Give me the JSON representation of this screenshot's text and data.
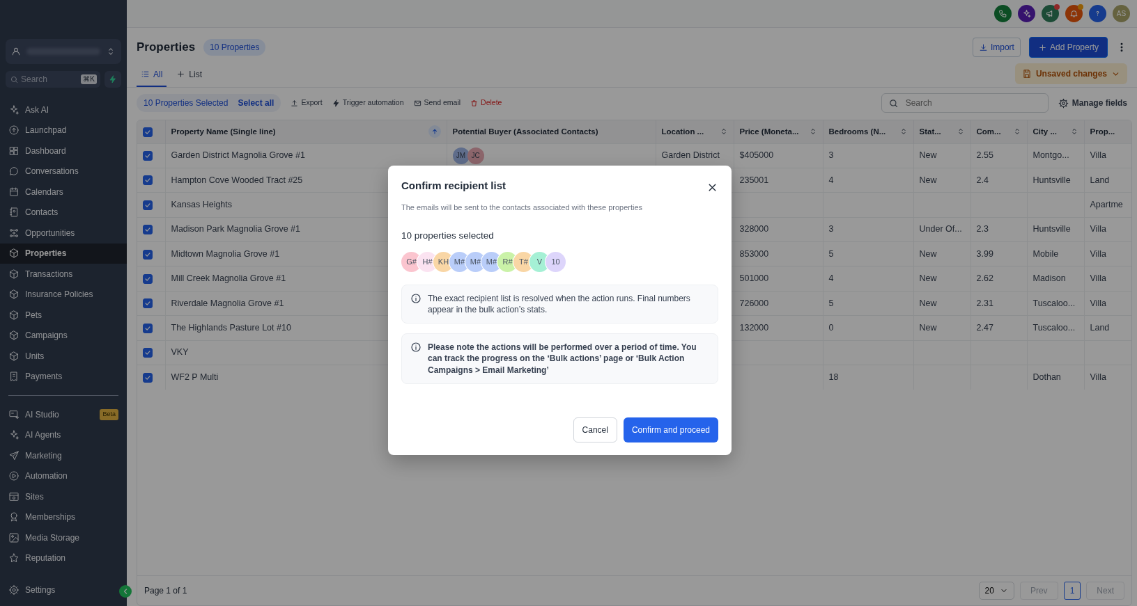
{
  "top_bar": {
    "icons": [
      {
        "notify": false
      },
      {
        "notify": false
      },
      {
        "notify": true
      },
      {
        "notify": true
      },
      {
        "notify": false
      }
    ],
    "avatar": "AS"
  },
  "sidebar": {
    "search": {
      "placeholder": "Search",
      "shortcut": "⌘K"
    },
    "nav": [
      {
        "label": "Ask AI",
        "selected": false
      },
      {
        "label": "Launchpad",
        "selected": false
      },
      {
        "label": "Dashboard",
        "selected": false
      },
      {
        "label": "Conversations",
        "selected": false
      },
      {
        "label": "Calendars",
        "selected": false
      },
      {
        "label": "Contacts",
        "selected": false
      },
      {
        "label": "Opportunities",
        "selected": false
      },
      {
        "label": "Properties",
        "selected": true
      },
      {
        "label": "Transactions",
        "selected": false
      },
      {
        "label": "Insurance Policies",
        "selected": false
      },
      {
        "label": "Pets",
        "selected": false
      },
      {
        "label": "Campaigns",
        "selected": false
      },
      {
        "label": "Units",
        "selected": false
      },
      {
        "label": "Payments",
        "selected": false
      }
    ],
    "tools": [
      {
        "label": "AI Studio",
        "badge": "Beta"
      },
      {
        "label": "AI Agents"
      },
      {
        "label": "Marketing"
      },
      {
        "label": "Automation"
      },
      {
        "label": "Sites"
      },
      {
        "label": "Memberships"
      },
      {
        "label": "Media Storage"
      },
      {
        "label": "Reputation"
      }
    ],
    "settings": "Settings"
  },
  "header": {
    "title": "Properties",
    "count": "10 Properties",
    "import": "Import",
    "add": "Add Property"
  },
  "tabs": [
    {
      "label": "All",
      "selected": true
    },
    {
      "label": "List",
      "selected": false
    }
  ],
  "unsaved": "Unsaved changes",
  "bulk": {
    "selected": "10 Properties Selected",
    "select_all": "Select all",
    "actions": [
      {
        "label": "Export",
        "kind": "export"
      },
      {
        "label": "Trigger automation",
        "kind": "automation"
      },
      {
        "label": "Send email",
        "kind": "email"
      },
      {
        "label": "Delete",
        "kind": "delete"
      }
    ]
  },
  "search": {
    "placeholder": "Search"
  },
  "manage_fields": "Manage fields",
  "table": {
    "all_checked": true,
    "columns": [
      {
        "label": "Property Name (Single line)",
        "sortable": true,
        "sorted": true
      },
      {
        "label": "Potential Buyer (Associated Contacts)",
        "sortable": false
      },
      {
        "label": "Location ...",
        "sortable": true,
        "sorted": false
      },
      {
        "label": "Price (Moneta...",
        "sortable": true,
        "sorted": false
      },
      {
        "label": "Bedrooms (N...",
        "sortable": true,
        "sorted": false
      },
      {
        "label": "Stat...",
        "sortable": true,
        "sorted": false
      },
      {
        "label": "Com...",
        "sortable": true,
        "sorted": false
      },
      {
        "label": "City ...",
        "sortable": true,
        "sorted": false
      },
      {
        "label": "Prop...",
        "sortable": false
      }
    ],
    "rows": [
      {
        "checked": true,
        "name": "Garden District Magnolia Grove #1",
        "buyers": [
          {
            "initials": "JM"
          },
          {
            "initials": "JC"
          }
        ],
        "location": "Garden District",
        "price": "$405000",
        "bedrooms": "3",
        "status": "New",
        "com": "2.55",
        "city": "Montgo...",
        "prop": "Villa"
      },
      {
        "checked": true,
        "name": "Hampton Cove Wooded Tract #25",
        "price": "235001",
        "bedrooms": "4",
        "status": "New",
        "com": "2.4",
        "city": "Huntsville",
        "prop": "Land"
      },
      {
        "checked": true,
        "name": "Kansas Heights",
        "prop": "Apartme"
      },
      {
        "checked": true,
        "name": "Madison Park Magnolia Grove #1",
        "price": "328000",
        "bedrooms": "3",
        "status": "Under Of...",
        "com": "2.3",
        "city": "Huntsville",
        "prop": "Villa"
      },
      {
        "checked": true,
        "name": "Midtown Magnolia Grove #1",
        "price": "853000",
        "bedrooms": "5",
        "status": "New",
        "com": "3.99",
        "city": "Mobile",
        "prop": "Villa"
      },
      {
        "checked": true,
        "name": "Mill Creek Magnolia Grove #1",
        "price": "501000",
        "bedrooms": "4",
        "status": "New",
        "com": "2.62",
        "city": "Madison",
        "prop": "Villa"
      },
      {
        "checked": true,
        "name": "Riverdale Magnolia Grove #1",
        "price": "726000",
        "bedrooms": "5",
        "status": "New",
        "com": "2.31",
        "city": "Tuscaloo...",
        "prop": "Villa"
      },
      {
        "checked": true,
        "name": "The Highlands Pasture Lot #10",
        "price": "132000",
        "bedrooms": "0",
        "status": "New",
        "com": "2.47",
        "city": "Tuscaloo...",
        "prop": "Land"
      },
      {
        "checked": true,
        "name": "VKY"
      },
      {
        "checked": true,
        "name": "WF2 P Multi",
        "bedrooms": "18",
        "city": "Dothan",
        "prop": "Villa"
      }
    ]
  },
  "pagination": {
    "info": "Page 1 of 1",
    "page_size": "20",
    "prev": {
      "label": "Prev",
      "disabled": true
    },
    "pages": [
      {
        "label": "1",
        "selected": true
      }
    ],
    "next": {
      "label": "Next",
      "disabled": true
    }
  },
  "modal": {
    "title": "Confirm recipient list",
    "subtitle": "The emails will be sent to the contacts associated with these properties",
    "count": "10 properties selected",
    "avatars": [
      {
        "initials": "G#",
        "color": "#fbc5cf"
      },
      {
        "initials": "H#",
        "color": "#fbe3f1"
      },
      {
        "initials": "KH",
        "color": "#f9d6a5"
      },
      {
        "initials": "M#",
        "color": "#b9cdf9"
      },
      {
        "initials": "M#",
        "color": "#b9cdf9"
      },
      {
        "initials": "M#",
        "color": "#b9cdf9"
      },
      {
        "initials": "R#",
        "color": "#caf2a8"
      },
      {
        "initials": "T#",
        "color": "#f9d6a5"
      },
      {
        "initials": "V",
        "color": "#a5f0d5"
      },
      {
        "initials": "10",
        "color": "#ddd5fb"
      }
    ],
    "notes": [
      {
        "text": "The exact recipient list is resolved when the action runs. Final numbers appear in the bulk action’s stats.",
        "emphasis": false
      },
      {
        "text": "Please note the actions will be performed over a period of time. You can track the progress on the ‘Bulk actions’ page or ‘Bulk Action Campaigns > Email Marketing’",
        "emphasis": true
      }
    ],
    "cancel": "Cancel",
    "confirm": "Confirm and proceed"
  }
}
